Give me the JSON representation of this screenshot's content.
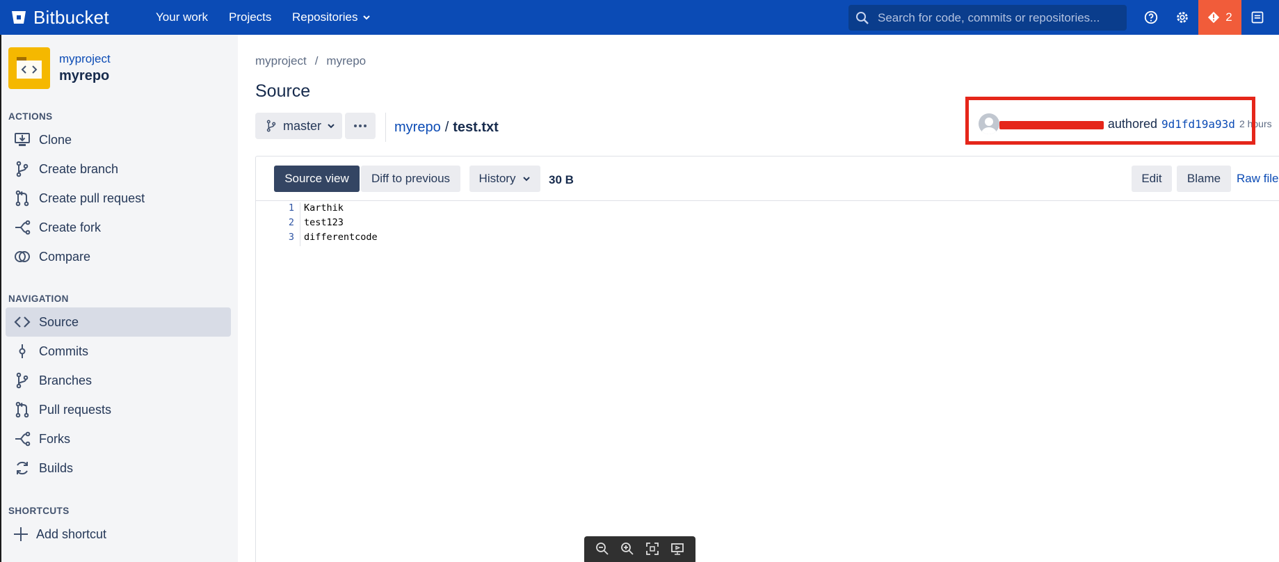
{
  "topbar": {
    "brand": "Bitbucket",
    "nav": {
      "your_work": "Your work",
      "projects": "Projects",
      "repositories": "Repositories"
    },
    "search": {
      "placeholder": "Search for code, commits or repositories..."
    },
    "alert_count": "2",
    "colors": {
      "bar": "#0b4bb5",
      "alert": "#f15c3a"
    },
    "icons": [
      "bitbucket-logo-icon",
      "chevron-down-icon",
      "search-icon",
      "help-icon",
      "settings-icon",
      "alert-icon",
      "profile-card-icon"
    ]
  },
  "sidebar": {
    "project": "myproject",
    "repo": "myrepo",
    "actions_title": "ACTIONS",
    "actions": [
      {
        "label": "Clone",
        "icon": "clone-icon"
      },
      {
        "label": "Create branch",
        "icon": "branch-icon"
      },
      {
        "label": "Create pull request",
        "icon": "pull-request-icon"
      },
      {
        "label": "Create fork",
        "icon": "fork-icon"
      },
      {
        "label": "Compare",
        "icon": "compare-icon"
      }
    ],
    "navigation_title": "NAVIGATION",
    "navigation": [
      {
        "label": "Source",
        "icon": "code-icon",
        "active": true
      },
      {
        "label": "Commits",
        "icon": "commit-icon"
      },
      {
        "label": "Branches",
        "icon": "branch-icon"
      },
      {
        "label": "Pull requests",
        "icon": "pull-request-icon"
      },
      {
        "label": "Forks",
        "icon": "fork-icon"
      },
      {
        "label": "Builds",
        "icon": "builds-icon"
      }
    ],
    "shortcuts_title": "SHORTCUTS",
    "add_shortcut": "Add shortcut"
  },
  "main": {
    "breadcrumb": {
      "project": "myproject",
      "sep": "/",
      "repo": "myrepo"
    },
    "title": "Source",
    "branch": "master",
    "path": {
      "repo": "myrepo",
      "sep": "/",
      "file": "test.txt"
    },
    "commit": {
      "authored": "authored",
      "hash": "9d1fd19a93d",
      "time": "2 hours"
    },
    "toolbar": {
      "source_view": "Source view",
      "diff": "Diff to previous",
      "history": "History",
      "size": "30 B",
      "edit": "Edit",
      "blame": "Blame",
      "raw": "Raw file"
    },
    "code_lines": [
      {
        "num": "1",
        "text": "Karthik"
      },
      {
        "num": "2",
        "text": "test123"
      },
      {
        "num": "3",
        "text": "differentcode"
      }
    ]
  },
  "zoom_toolbar": {
    "icons": [
      "zoom-out-icon",
      "zoom-in-icon",
      "fit-screen-icon",
      "present-icon"
    ]
  }
}
